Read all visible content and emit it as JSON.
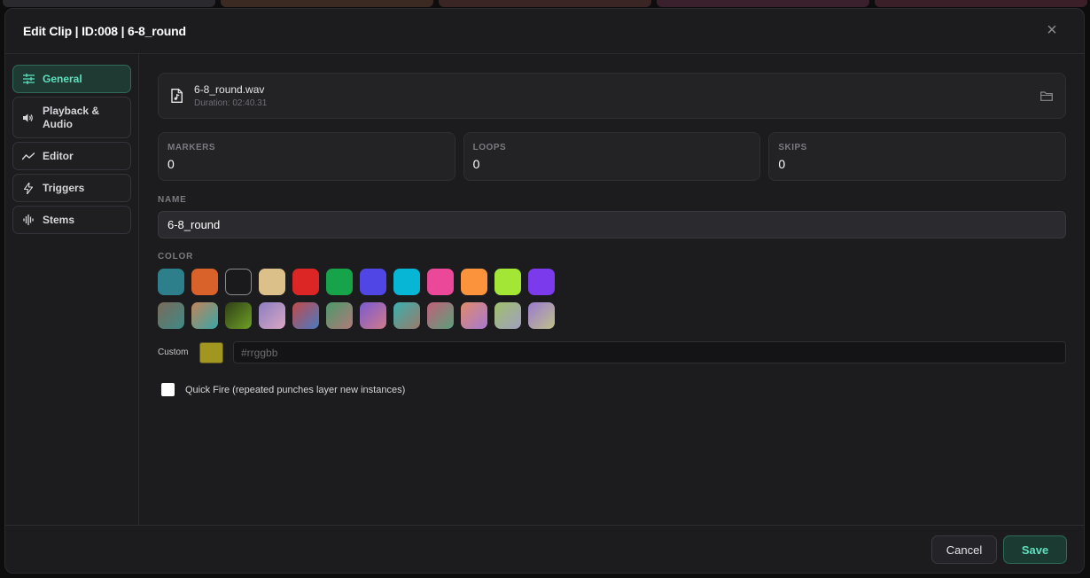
{
  "dialog": {
    "title": "Edit Clip | ID:008 | 6-8_round",
    "close_symbol": "×"
  },
  "sidebar": {
    "items": [
      {
        "label": "General",
        "icon": "sliders-icon",
        "active": true
      },
      {
        "label": "Playback & Audio",
        "icon": "speaker-icon",
        "active": false
      },
      {
        "label": "Editor",
        "icon": "line-chart-icon",
        "active": false
      },
      {
        "label": "Triggers",
        "icon": "lightning-icon",
        "active": false
      },
      {
        "label": "Stems",
        "icon": "waveform-icon",
        "active": false
      }
    ]
  },
  "file": {
    "name": "6-8_round.wav",
    "duration": "Duration: 02:40.31",
    "icon": "audio-file-icon",
    "folder_icon": "folder-icon"
  },
  "stats": [
    {
      "label": "MARKERS",
      "value": "0"
    },
    {
      "label": "LOOPS",
      "value": "0"
    },
    {
      "label": "SKIPS",
      "value": "0"
    }
  ],
  "name_field": {
    "label": "NAME",
    "value": "6-8_round"
  },
  "color": {
    "label": "COLOR",
    "solid": [
      "#2e7f8c",
      "#d8622a",
      "#1a1a1c",
      "#dcc089",
      "#dc2626",
      "#16a34a",
      "#4f46e5",
      "#06b6d4",
      "#ec4899",
      "#fb923c",
      "#a3e635",
      "#7c3aed"
    ],
    "gradients": [
      [
        "#7a6a5a",
        "#3e8a86"
      ],
      [
        "#c0845a",
        "#3aa6a6"
      ],
      [
        "#2f3f18",
        "#6fa025"
      ],
      [
        "#8c7fc0",
        "#d9a6c6"
      ],
      [
        "#c24a4a",
        "#4a7ac2"
      ],
      [
        "#4a9a6a",
        "#b07a7a"
      ],
      [
        "#7a5ad0",
        "#d07a8a"
      ],
      [
        "#3ab0b0",
        "#9a7a6a"
      ],
      [
        "#c2607a",
        "#5aa07a"
      ],
      [
        "#e08a6a",
        "#a87ad0"
      ],
      [
        "#a0c06a",
        "#a0a0c0"
      ],
      [
        "#9a7ad0",
        "#c0c08a"
      ]
    ],
    "selected_index": 2,
    "custom_label": "Custom",
    "custom_value": "#a1961f",
    "hex_placeholder": "#rrggbb"
  },
  "quick_fire": {
    "label": "Quick Fire (repeated punches layer new instances)",
    "checked": false
  },
  "footer": {
    "cancel_label": "Cancel",
    "save_label": "Save"
  }
}
